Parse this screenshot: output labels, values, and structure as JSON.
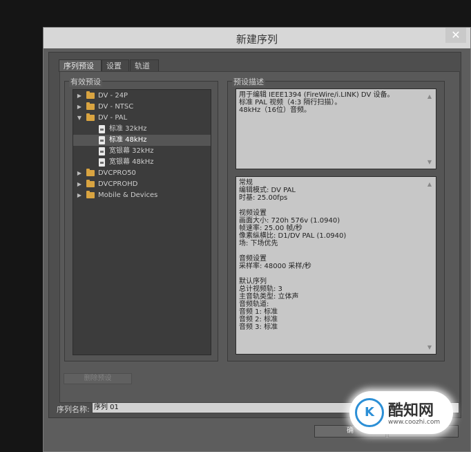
{
  "dialog": {
    "title": "新建序列",
    "close_glyph": "✕",
    "tabs": [
      {
        "label": "序列预设",
        "active": true
      },
      {
        "label": "设置",
        "active": false
      },
      {
        "label": "轨道",
        "active": false
      }
    ],
    "presets_label": "有效预设",
    "desc_label": "预设描述",
    "tree": [
      {
        "label": "DV - 24P",
        "type": "folder",
        "expanded": false,
        "level": 0
      },
      {
        "label": "DV - NTSC",
        "type": "folder",
        "expanded": false,
        "level": 0
      },
      {
        "label": "DV - PAL",
        "type": "folder",
        "expanded": true,
        "level": 0
      },
      {
        "label": "标准 32kHz",
        "type": "file",
        "level": 1
      },
      {
        "label": "标准 48kHz",
        "type": "file",
        "level": 1,
        "selected": true
      },
      {
        "label": "宽银幕 32kHz",
        "type": "file",
        "level": 1
      },
      {
        "label": "宽银幕 48kHz",
        "type": "file",
        "level": 1
      },
      {
        "label": "DVCPRO50",
        "type": "folder",
        "expanded": false,
        "level": 0
      },
      {
        "label": "DVCPROHD",
        "type": "folder",
        "expanded": false,
        "level": 0
      },
      {
        "label": "Mobile & Devices",
        "type": "folder",
        "expanded": false,
        "level": 0
      }
    ],
    "description": [
      "用于编辑 IEEE1394 (FireWire/i.LINK) DV 设备。",
      "标准 PAL 视频（4:3 隔行扫描）。",
      "48kHz（16位）音频。"
    ],
    "details": [
      "常规",
      " 编辑模式: DV PAL",
      " 时基: 25.00fps",
      "",
      "视频设置",
      " 画面大小: 720h 576v (1.0940)",
      " 帧速率: 25.00 帧/秒",
      " 像素纵横比: D1/DV PAL (1.0940)",
      " 场: 下场优先",
      "",
      "音频设置",
      " 采样率: 48000 采样/秒",
      "",
      "默认序列",
      " 总计视频轨: 3",
      " 主音轨类型: 立体声",
      " 音频轨道:",
      " 音频 1: 标准",
      " 音频 2: 标准",
      " 音频 3: 标准"
    ],
    "delete_preset_label": "删除预设",
    "sequence_name_label": "序列名称:",
    "sequence_name_value": "序列 01",
    "ok_label": "确",
    "scroll_up_glyph": "▲",
    "scroll_down_glyph": "▼"
  },
  "watermark": {
    "logo_text": "K",
    "name": "酷知网",
    "url": "www.coozhi.com"
  }
}
